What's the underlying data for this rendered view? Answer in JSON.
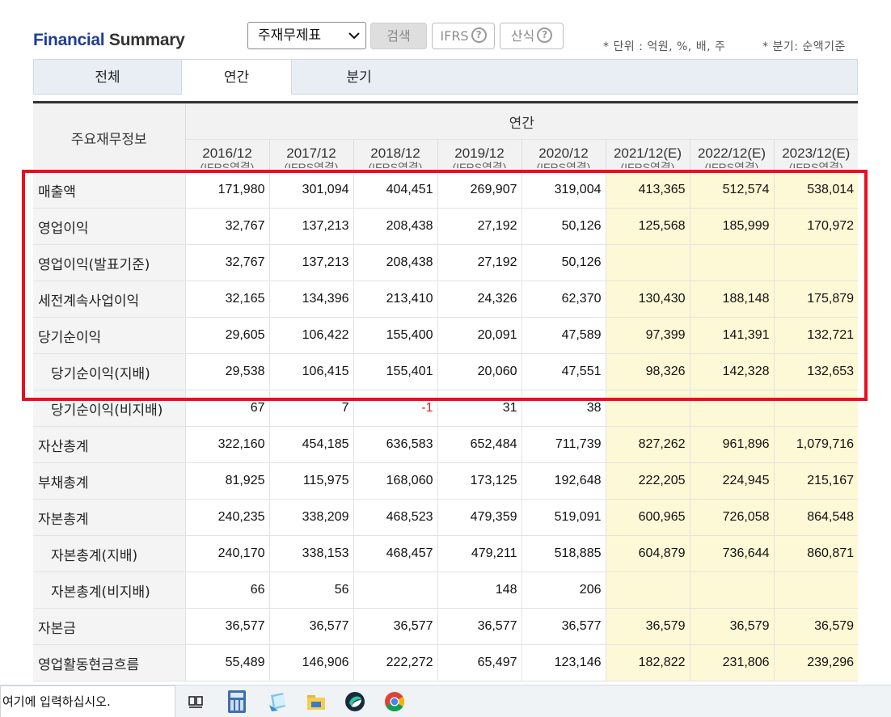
{
  "header": {
    "title_part1": "Financial",
    "title_part2": "Summary",
    "select_value": "주재무제표",
    "search_button": "검색",
    "ifrs_button": "IFRS",
    "calc_button": "산식",
    "help_glyph": "?",
    "unit_note": "* 단위 : 억원, %, 배, 주",
    "quarter_note": "* 분기: 순액기준"
  },
  "tabs": [
    {
      "label": "전체"
    },
    {
      "label": "연간"
    },
    {
      "label": "분기"
    }
  ],
  "table": {
    "corner_label": "주요재무정보",
    "group_label": "연간",
    "columns": [
      {
        "year": "2016/12",
        "sub": "(IFRS연결)"
      },
      {
        "year": "2017/12",
        "sub": "(IFRS연결)"
      },
      {
        "year": "2018/12",
        "sub": "(IFRS연결)"
      },
      {
        "year": "2019/12",
        "sub": "(IFRS연결)"
      },
      {
        "year": "2020/12",
        "sub": "(IFRS연결)"
      },
      {
        "year": "2021/12(E)",
        "sub": "(IFRS연결)"
      },
      {
        "year": "2022/12(E)",
        "sub": "(IFRS연결)"
      },
      {
        "year": "2023/12(E)",
        "sub": "(IFRS연결)"
      }
    ],
    "rows": [
      {
        "label": "매출액",
        "values": [
          "171,980",
          "301,094",
          "404,451",
          "269,907",
          "319,004",
          "413,365",
          "512,574",
          "538,014"
        ]
      },
      {
        "label": "영업이익",
        "values": [
          "32,767",
          "137,213",
          "208,438",
          "27,192",
          "50,126",
          "125,568",
          "185,999",
          "170,972"
        ]
      },
      {
        "label": "영업이익(발표기준)",
        "values": [
          "32,767",
          "137,213",
          "208,438",
          "27,192",
          "50,126",
          "",
          "",
          ""
        ]
      },
      {
        "label": "세전계속사업이익",
        "values": [
          "32,165",
          "134,396",
          "213,410",
          "24,326",
          "62,370",
          "130,430",
          "188,148",
          "175,879"
        ]
      },
      {
        "label": "당기순이익",
        "values": [
          "29,605",
          "106,422",
          "155,400",
          "20,091",
          "47,589",
          "97,399",
          "141,391",
          "132,721"
        ]
      },
      {
        "label": "당기순이익(지배)",
        "values": [
          "29,538",
          "106,415",
          "155,401",
          "20,060",
          "47,551",
          "98,326",
          "142,328",
          "132,653"
        ]
      },
      {
        "label": "당기순이익(비지배)",
        "values": [
          "67",
          "7",
          "-1",
          "31",
          "38",
          "",
          "",
          ""
        ]
      },
      {
        "label": "자산총계",
        "values": [
          "322,160",
          "454,185",
          "636,583",
          "652,484",
          "711,739",
          "827,262",
          "961,896",
          "1,079,716"
        ]
      },
      {
        "label": "부채총계",
        "values": [
          "81,925",
          "115,975",
          "168,060",
          "173,125",
          "192,648",
          "222,205",
          "224,945",
          "215,167"
        ]
      },
      {
        "label": "자본총계",
        "values": [
          "240,235",
          "338,209",
          "468,523",
          "479,359",
          "519,091",
          "600,965",
          "726,058",
          "864,548"
        ]
      },
      {
        "label": "자본총계(지배)",
        "values": [
          "240,170",
          "338,153",
          "468,457",
          "479,211",
          "518,885",
          "604,879",
          "736,644",
          "860,871"
        ]
      },
      {
        "label": "자본총계(비지배)",
        "values": [
          "66",
          "56",
          "",
          "148",
          "206",
          "",
          "",
          ""
        ]
      },
      {
        "label": "자본금",
        "values": [
          "36,577",
          "36,577",
          "36,577",
          "36,577",
          "36,577",
          "36,579",
          "36,579",
          "36,579"
        ]
      },
      {
        "label": "영업활동현금흐름",
        "values": [
          "55,489",
          "146,906",
          "222,272",
          "65,497",
          "123,146",
          "182,822",
          "231,806",
          "239,296"
        ]
      }
    ]
  },
  "taskbar": {
    "search_placeholder": "여기에 입력하십시오.",
    "apps": [
      "task-view",
      "calculator",
      "sticky-notes",
      "file-explorer",
      "app",
      "chrome"
    ]
  },
  "colors": {
    "title_blue": "#1f3f8f",
    "estimate_bg": "#fdf8d5",
    "highlight_red": "#e8101e",
    "negative_red": "#dd2222"
  }
}
